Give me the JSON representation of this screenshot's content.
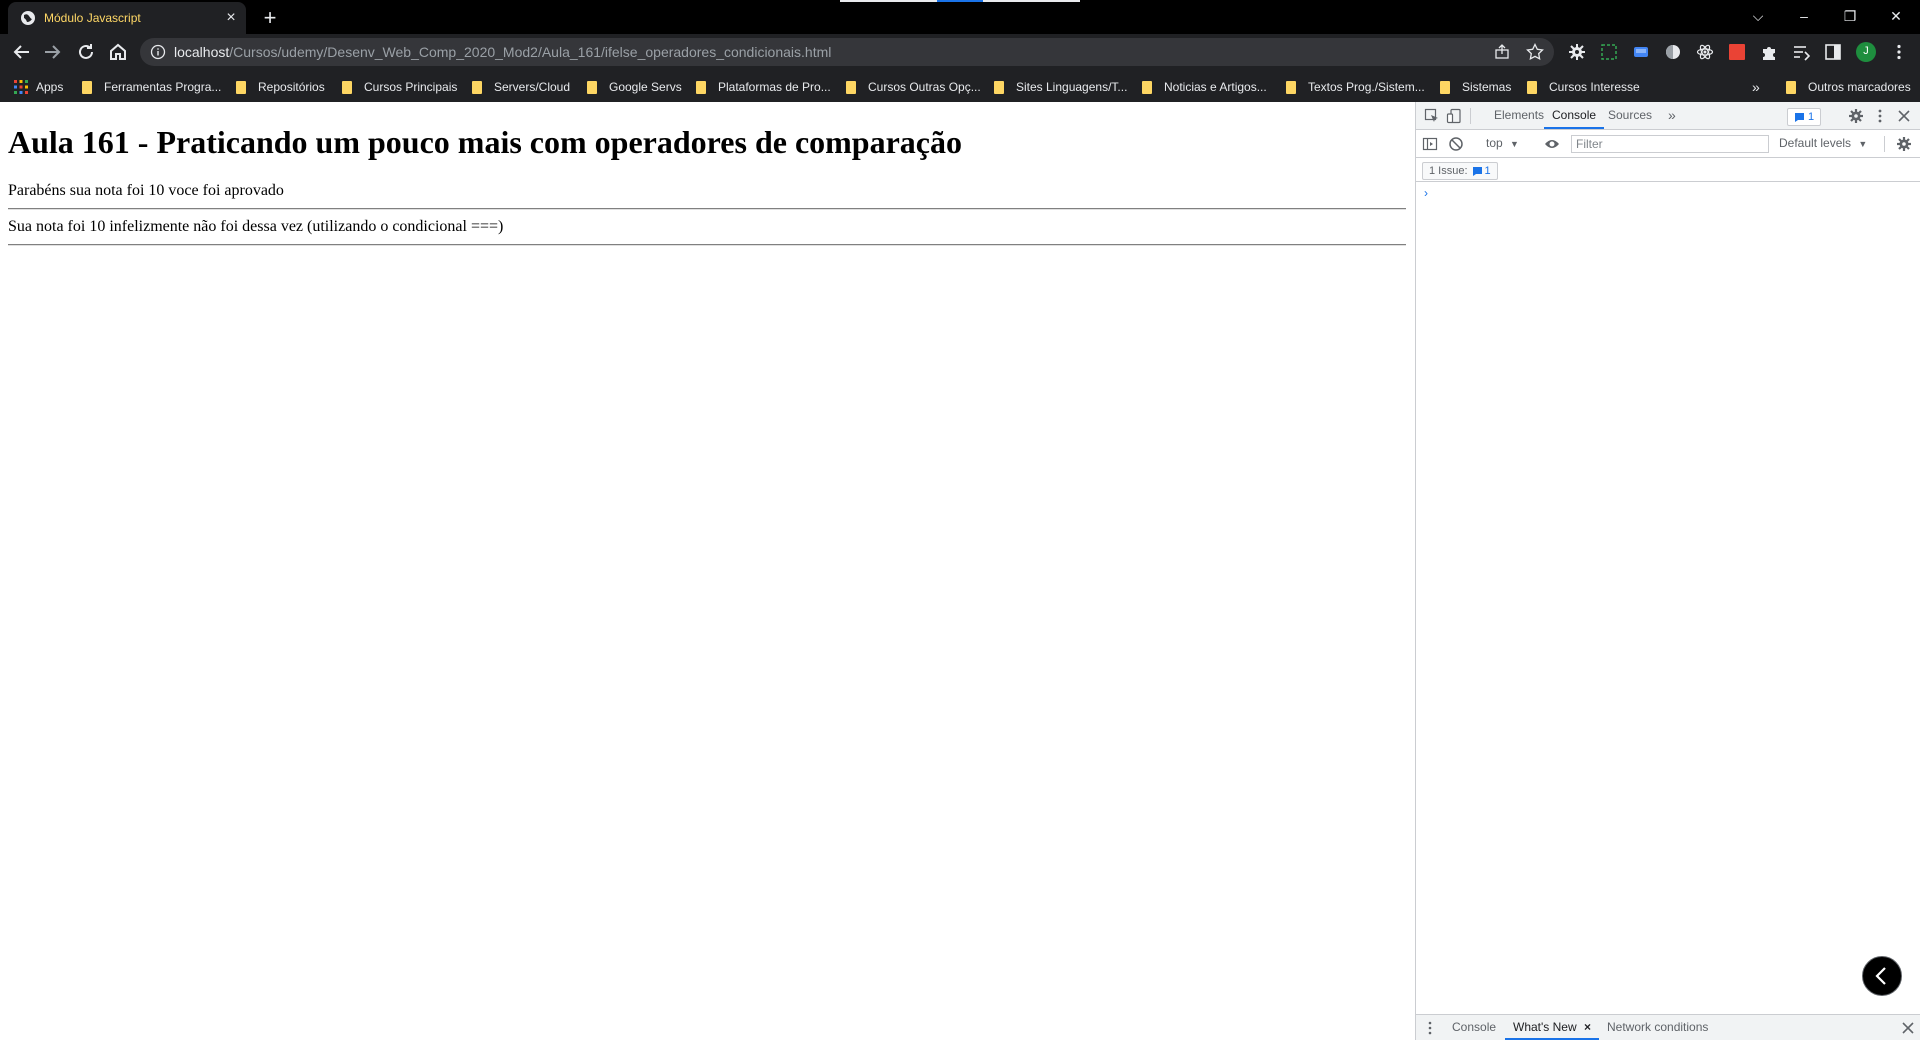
{
  "tab": {
    "title": "Módulo Javascript",
    "close": "×",
    "new_tab": "+"
  },
  "window_controls": {
    "menu": "⌵",
    "minimize": "–",
    "restore": "❐",
    "close": "✕"
  },
  "address": {
    "host": "localhost",
    "path": "/Cursos/udemy/Desenv_Web_Comp_2020_Mod2/Aula_161/ifelse_operadores_condicionais.html"
  },
  "profile": {
    "initial": "J",
    "color": "#1e8e3e"
  },
  "bookmarks": {
    "apps": "Apps",
    "items": [
      "Ferramentas Progra...",
      "Repositórios",
      "Cursos Principais",
      "Servers/Cloud",
      "Google Servs",
      "Plataformas de Pro...",
      "Cursos Outras Opç...",
      "Sites Linguagens/T...",
      "Noticias e Artigos...",
      "Textos Prog./Sistem...",
      "Sistemas",
      "Cursos Interesse"
    ],
    "more": "»",
    "other": "Outros marcadores"
  },
  "page": {
    "heading": "Aula 161 - Praticando um pouco mais com operadores de comparação",
    "line1": "Parabéns sua nota foi 10 voce foi aprovado",
    "line2": "Sua nota foi 10 infelizmente não foi dessa vez (utilizando o condicional ===)"
  },
  "devtools": {
    "tabs": [
      "Elements",
      "Console",
      "Sources"
    ],
    "active_tab": "Console",
    "more_tabs": "»",
    "issue_badge_count": "1",
    "context": "top",
    "filter_placeholder": "Filter",
    "levels": "Default levels",
    "issues_label": "1 Issue:",
    "issues_count": "1",
    "prompt": "›",
    "drawer_tabs": [
      "Console",
      "What's New",
      "Network conditions"
    ],
    "drawer_active": "What's New",
    "drawer_close": "×"
  },
  "colors": {
    "accent": "#1a73e8",
    "folder": "#fdd663",
    "tab_title": "#ffd866"
  }
}
